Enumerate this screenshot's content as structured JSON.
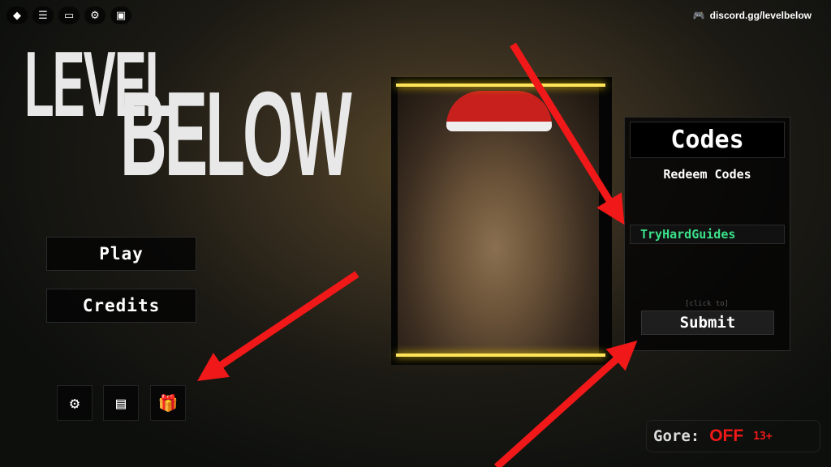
{
  "topbar": {
    "icons": [
      "roblox-icon",
      "menu-icon",
      "chat-icon",
      "settings-icon",
      "backpack-icon"
    ]
  },
  "discord": {
    "label": "discord.gg/levelbelow"
  },
  "logo": {
    "line1": "LEVEL",
    "line2": "BELOW"
  },
  "menu": {
    "play": "Play",
    "credits": "Credits"
  },
  "bottom_icons": [
    "gear-icon",
    "notes-icon",
    "gift-icon"
  ],
  "codes": {
    "title": "Codes",
    "subtitle": "Redeem Codes",
    "input_value": "TryHardGuides",
    "hint": "[click to]",
    "submit": "Submit"
  },
  "gore": {
    "label": "Gore:",
    "value": "OFF",
    "age": "13+"
  },
  "colors": {
    "accent_green": "#3be08a",
    "gore_red": "#f01818",
    "arrow_red": "#f01818",
    "frame_glow": "#ffe45a"
  }
}
